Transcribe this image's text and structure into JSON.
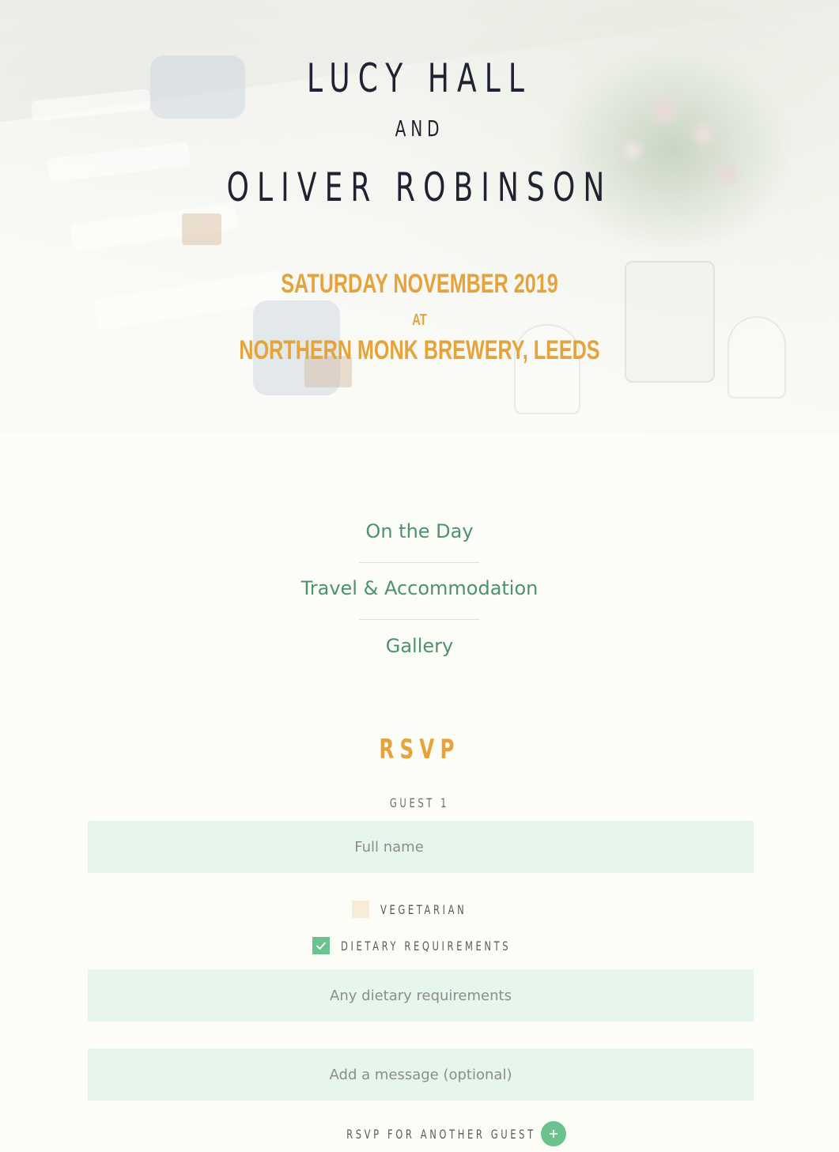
{
  "hero": {
    "partner_one": "LUCY HALL",
    "conjunction": "AND",
    "partner_two": "OLIVER ROBINSON",
    "date": "SATURDAY NOVEMBER 2019",
    "at": "AT",
    "venue": "NORTHERN MONK BREWERY, LEEDS"
  },
  "nav": {
    "items": [
      {
        "label": "On the Day"
      },
      {
        "label": "Travel & Accommodation"
      },
      {
        "label": "Gallery"
      }
    ]
  },
  "rsvp": {
    "title": "RSVP",
    "guest_label": "GUEST 1",
    "full_name": {
      "placeholder": "Full name",
      "value": ""
    },
    "vegetarian": {
      "label": "VEGETARIAN",
      "checked": false
    },
    "dietary": {
      "label": "DIETARY REQUIREMENTS",
      "checked": true
    },
    "dietary_field": {
      "placeholder": "Any dietary requirements",
      "value": ""
    },
    "message_field": {
      "placeholder": "Add a message (optional)",
      "value": ""
    },
    "add_guest_label": "RSVP FOR ANOTHER GUEST"
  },
  "colors": {
    "accent_orange": "#e6a33c",
    "link_green": "#4a9270",
    "check_green": "#6cc28f",
    "field_bg": "#e7f6ec",
    "unchecked_bg": "#f8ecd8",
    "heading_dark": "#1f2230"
  },
  "icons": {
    "checkbox_checked": "checkmark-icon",
    "add_guest": "plus-icon"
  }
}
